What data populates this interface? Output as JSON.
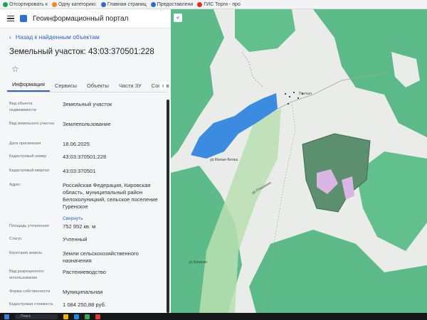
{
  "bookmarks": [
    {
      "label": "Отсортировать к",
      "color": "#1aa35a"
    },
    {
      "label": "Одну категорию:",
      "color": "#f08a24"
    },
    {
      "label": "Главная страниц",
      "color": "#2b6ed2"
    },
    {
      "label": "Предоставлени",
      "color": "#2b6ed2"
    },
    {
      "label": "ГИС Торги - про",
      "color": "#d93025"
    }
  ],
  "header": {
    "title": "Геоинформационный портал"
  },
  "panel": {
    "back_label": "Назад к найденным объектам",
    "object_title": "Земельный участок: 43:03:370501:228",
    "tabs": [
      "Информация",
      "Сервисы",
      "Объекты",
      "Части ЗУ",
      "Состав"
    ],
    "attributes": [
      {
        "label": "Вид объекта недвижимости",
        "value": "Земельный участок"
      },
      {
        "label": "Вид земельного участка",
        "value": "Землепользование"
      },
      {
        "label": "Дата присвоения",
        "value": "18.06.2025"
      },
      {
        "label": "Кадастровый номер",
        "value": "43:03:370501:228"
      },
      {
        "label": "Кадастровый квартал",
        "value": "43:03:370501"
      },
      {
        "label": "Адрес",
        "value": "Российская Федерация, Кировская область, муниципальный район Белохолуницкий, сельское поселение Гуренское"
      },
      {
        "label": "Площадь уточненная",
        "value": "752 952 кв. м"
      },
      {
        "label": "Статус",
        "value": "Учтенный"
      },
      {
        "label": "Категория земель",
        "value": "Земли сельскохозяйственного назначения"
      },
      {
        "label": "Вид разрешенного использования",
        "value": "Растениеводство"
      },
      {
        "label": "Форма собственности",
        "value": "Муниципальная"
      },
      {
        "label": "Кадастровая стоимость",
        "value": "1 084 250,88 руб."
      }
    ],
    "collapse_label": "Свернуть"
  },
  "map": {
    "labels": [
      "Пантыл",
      "ур.Малые-Бегаш",
      "ур.Плишкино",
      "ур.Кукушки"
    ]
  },
  "taskbar": {
    "search_placeholder": "Поиск"
  },
  "colors": {
    "accent": "#2a62c9",
    "forest": "#5dbb8a",
    "water": "#3b8be0",
    "parcel": "#5b8f6e"
  }
}
